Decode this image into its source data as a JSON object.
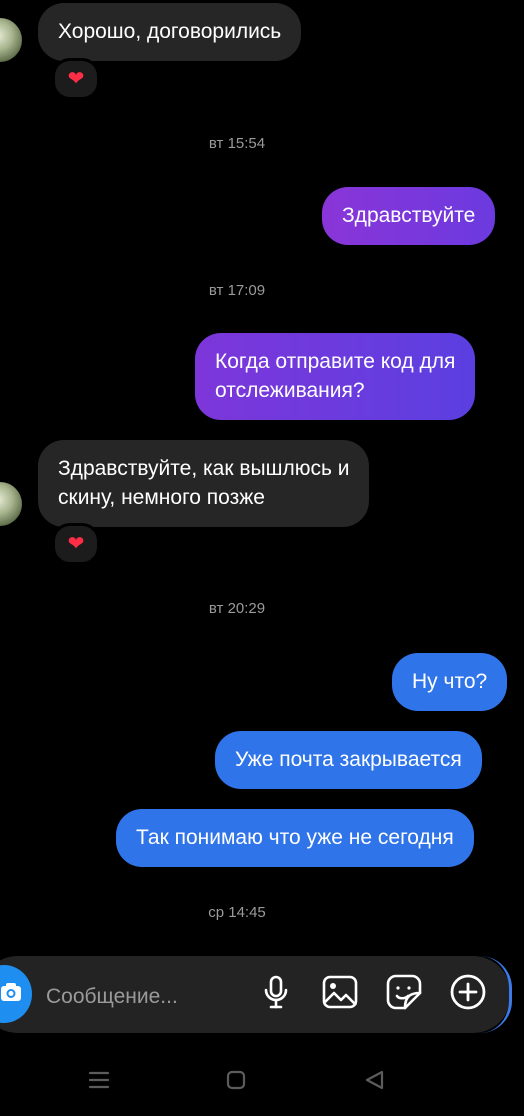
{
  "messages": [
    {
      "text_lines": [
        "Хорошо, договорились"
      ],
      "reaction": "❤"
    },
    {
      "timestamp": "вт 15:54"
    },
    {
      "text_lines": [
        "Здравствуйте"
      ]
    },
    {
      "timestamp": "вт 17:09"
    },
    {
      "text_lines": [
        "Когда отправите код для",
        "отслеживания?"
      ]
    },
    {
      "text_lines": [
        "Здравствуйте, как вышлюсь и",
        "скину, немного позже"
      ],
      "reaction": "❤"
    },
    {
      "timestamp": "вт 20:29"
    },
    {
      "text_lines": [
        "Ну что?"
      ]
    },
    {
      "text_lines": [
        "Уже почта закрывается"
      ]
    },
    {
      "text_lines": [
        "Так понимаю что уже не сегодня"
      ]
    },
    {
      "timestamp": "ср 14:45"
    }
  ],
  "composer": {
    "placeholder": "Сообщение...",
    "icons": [
      "camera-icon",
      "microphone-icon",
      "image-icon",
      "sticker-icon",
      "add-icon"
    ]
  },
  "colors": {
    "background": "#000000",
    "incoming_bubble": "#262626",
    "outgoing_purple_start": "#8a35d8",
    "outgoing_purple_end": "#5b3fe0",
    "outgoing_blue": "#2f74e8",
    "timestamp": "#9a9a9a",
    "reaction_heart": "#ff2d46"
  },
  "navbar": {
    "icons": [
      "menu-icon",
      "home-icon",
      "back-icon"
    ]
  }
}
